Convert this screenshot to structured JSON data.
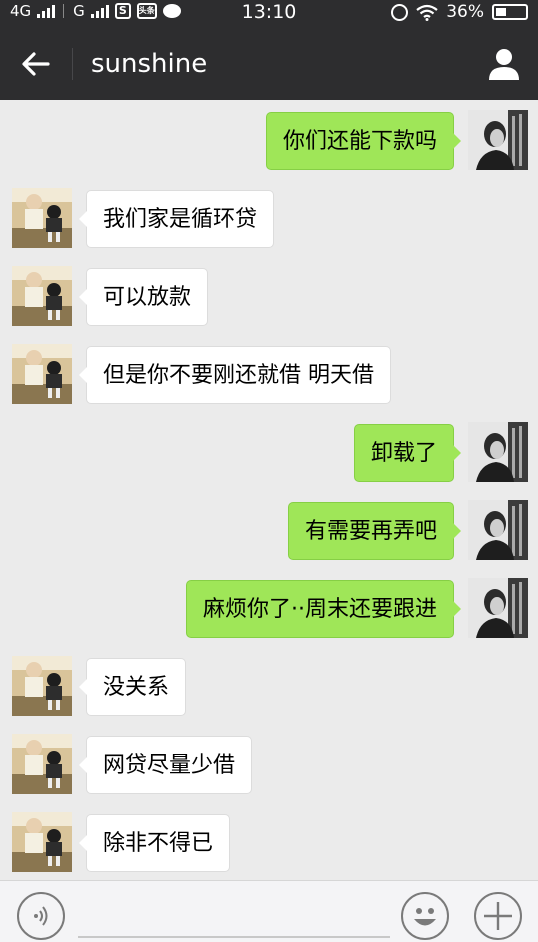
{
  "status_bar": {
    "network1": "4G",
    "network2": "G",
    "time": "13:10",
    "battery_percent": "36%"
  },
  "header": {
    "title": "sunshine"
  },
  "messages": [
    {
      "side": "right",
      "text": "你们还能下款吗"
    },
    {
      "side": "left",
      "text": "我们家是循环贷"
    },
    {
      "side": "left",
      "text": "可以放款"
    },
    {
      "side": "left",
      "text": "但是你不要刚还就借 明天借"
    },
    {
      "side": "right",
      "text": "卸载了"
    },
    {
      "side": "right",
      "text": "有需要再弄吧"
    },
    {
      "side": "right",
      "text": "麻烦你了··周末还要跟进"
    },
    {
      "side": "left",
      "text": "没关系"
    },
    {
      "side": "left",
      "text": "网贷尽量少借"
    },
    {
      "side": "left",
      "text": "除非不得已"
    }
  ],
  "colors": {
    "header_bg": "#2d2d2f",
    "chat_bg": "#ebebeb",
    "sent_bubble": "#9fe658",
    "received_bubble": "#ffffff"
  },
  "icons": {
    "back": "arrow-left-icon",
    "profile": "person-icon",
    "voice": "voice-icon",
    "emoji": "emoji-icon",
    "more": "plus-icon"
  }
}
